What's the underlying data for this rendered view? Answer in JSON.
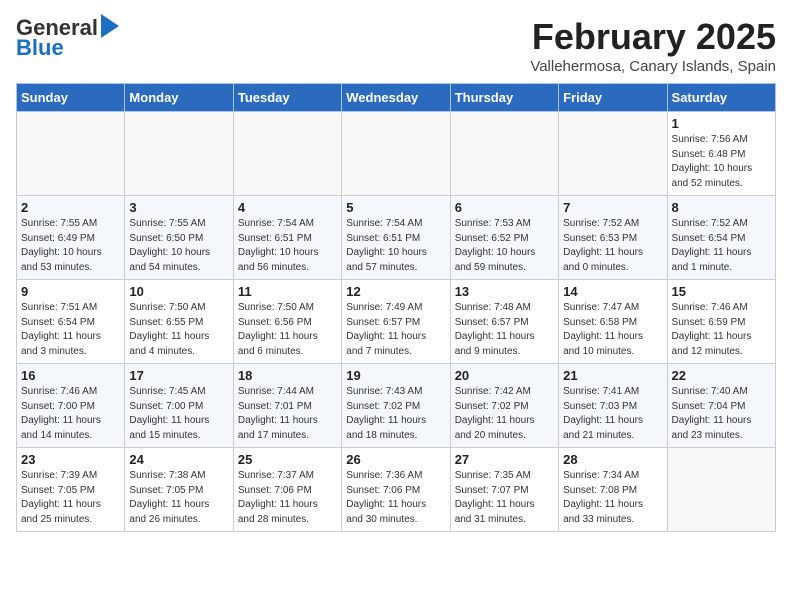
{
  "header": {
    "logo_general": "General",
    "logo_blue": "Blue",
    "month_title": "February 2025",
    "location": "Vallehermosa, Canary Islands, Spain"
  },
  "days_of_week": [
    "Sunday",
    "Monday",
    "Tuesday",
    "Wednesday",
    "Thursday",
    "Friday",
    "Saturday"
  ],
  "weeks": [
    [
      {
        "day": "",
        "info": ""
      },
      {
        "day": "",
        "info": ""
      },
      {
        "day": "",
        "info": ""
      },
      {
        "day": "",
        "info": ""
      },
      {
        "day": "",
        "info": ""
      },
      {
        "day": "",
        "info": ""
      },
      {
        "day": "1",
        "info": "Sunrise: 7:56 AM\nSunset: 6:48 PM\nDaylight: 10 hours\nand 52 minutes."
      }
    ],
    [
      {
        "day": "2",
        "info": "Sunrise: 7:55 AM\nSunset: 6:49 PM\nDaylight: 10 hours\nand 53 minutes."
      },
      {
        "day": "3",
        "info": "Sunrise: 7:55 AM\nSunset: 6:50 PM\nDaylight: 10 hours\nand 54 minutes."
      },
      {
        "day": "4",
        "info": "Sunrise: 7:54 AM\nSunset: 6:51 PM\nDaylight: 10 hours\nand 56 minutes."
      },
      {
        "day": "5",
        "info": "Sunrise: 7:54 AM\nSunset: 6:51 PM\nDaylight: 10 hours\nand 57 minutes."
      },
      {
        "day": "6",
        "info": "Sunrise: 7:53 AM\nSunset: 6:52 PM\nDaylight: 10 hours\nand 59 minutes."
      },
      {
        "day": "7",
        "info": "Sunrise: 7:52 AM\nSunset: 6:53 PM\nDaylight: 11 hours\nand 0 minutes."
      },
      {
        "day": "8",
        "info": "Sunrise: 7:52 AM\nSunset: 6:54 PM\nDaylight: 11 hours\nand 1 minute."
      }
    ],
    [
      {
        "day": "9",
        "info": "Sunrise: 7:51 AM\nSunset: 6:54 PM\nDaylight: 11 hours\nand 3 minutes."
      },
      {
        "day": "10",
        "info": "Sunrise: 7:50 AM\nSunset: 6:55 PM\nDaylight: 11 hours\nand 4 minutes."
      },
      {
        "day": "11",
        "info": "Sunrise: 7:50 AM\nSunset: 6:56 PM\nDaylight: 11 hours\nand 6 minutes."
      },
      {
        "day": "12",
        "info": "Sunrise: 7:49 AM\nSunset: 6:57 PM\nDaylight: 11 hours\nand 7 minutes."
      },
      {
        "day": "13",
        "info": "Sunrise: 7:48 AM\nSunset: 6:57 PM\nDaylight: 11 hours\nand 9 minutes."
      },
      {
        "day": "14",
        "info": "Sunrise: 7:47 AM\nSunset: 6:58 PM\nDaylight: 11 hours\nand 10 minutes."
      },
      {
        "day": "15",
        "info": "Sunrise: 7:46 AM\nSunset: 6:59 PM\nDaylight: 11 hours\nand 12 minutes."
      }
    ],
    [
      {
        "day": "16",
        "info": "Sunrise: 7:46 AM\nSunset: 7:00 PM\nDaylight: 11 hours\nand 14 minutes."
      },
      {
        "day": "17",
        "info": "Sunrise: 7:45 AM\nSunset: 7:00 PM\nDaylight: 11 hours\nand 15 minutes."
      },
      {
        "day": "18",
        "info": "Sunrise: 7:44 AM\nSunset: 7:01 PM\nDaylight: 11 hours\nand 17 minutes."
      },
      {
        "day": "19",
        "info": "Sunrise: 7:43 AM\nSunset: 7:02 PM\nDaylight: 11 hours\nand 18 minutes."
      },
      {
        "day": "20",
        "info": "Sunrise: 7:42 AM\nSunset: 7:02 PM\nDaylight: 11 hours\nand 20 minutes."
      },
      {
        "day": "21",
        "info": "Sunrise: 7:41 AM\nSunset: 7:03 PM\nDaylight: 11 hours\nand 21 minutes."
      },
      {
        "day": "22",
        "info": "Sunrise: 7:40 AM\nSunset: 7:04 PM\nDaylight: 11 hours\nand 23 minutes."
      }
    ],
    [
      {
        "day": "23",
        "info": "Sunrise: 7:39 AM\nSunset: 7:05 PM\nDaylight: 11 hours\nand 25 minutes."
      },
      {
        "day": "24",
        "info": "Sunrise: 7:38 AM\nSunset: 7:05 PM\nDaylight: 11 hours\nand 26 minutes."
      },
      {
        "day": "25",
        "info": "Sunrise: 7:37 AM\nSunset: 7:06 PM\nDaylight: 11 hours\nand 28 minutes."
      },
      {
        "day": "26",
        "info": "Sunrise: 7:36 AM\nSunset: 7:06 PM\nDaylight: 11 hours\nand 30 minutes."
      },
      {
        "day": "27",
        "info": "Sunrise: 7:35 AM\nSunset: 7:07 PM\nDaylight: 11 hours\nand 31 minutes."
      },
      {
        "day": "28",
        "info": "Sunrise: 7:34 AM\nSunset: 7:08 PM\nDaylight: 11 hours\nand 33 minutes."
      },
      {
        "day": "",
        "info": ""
      }
    ]
  ]
}
